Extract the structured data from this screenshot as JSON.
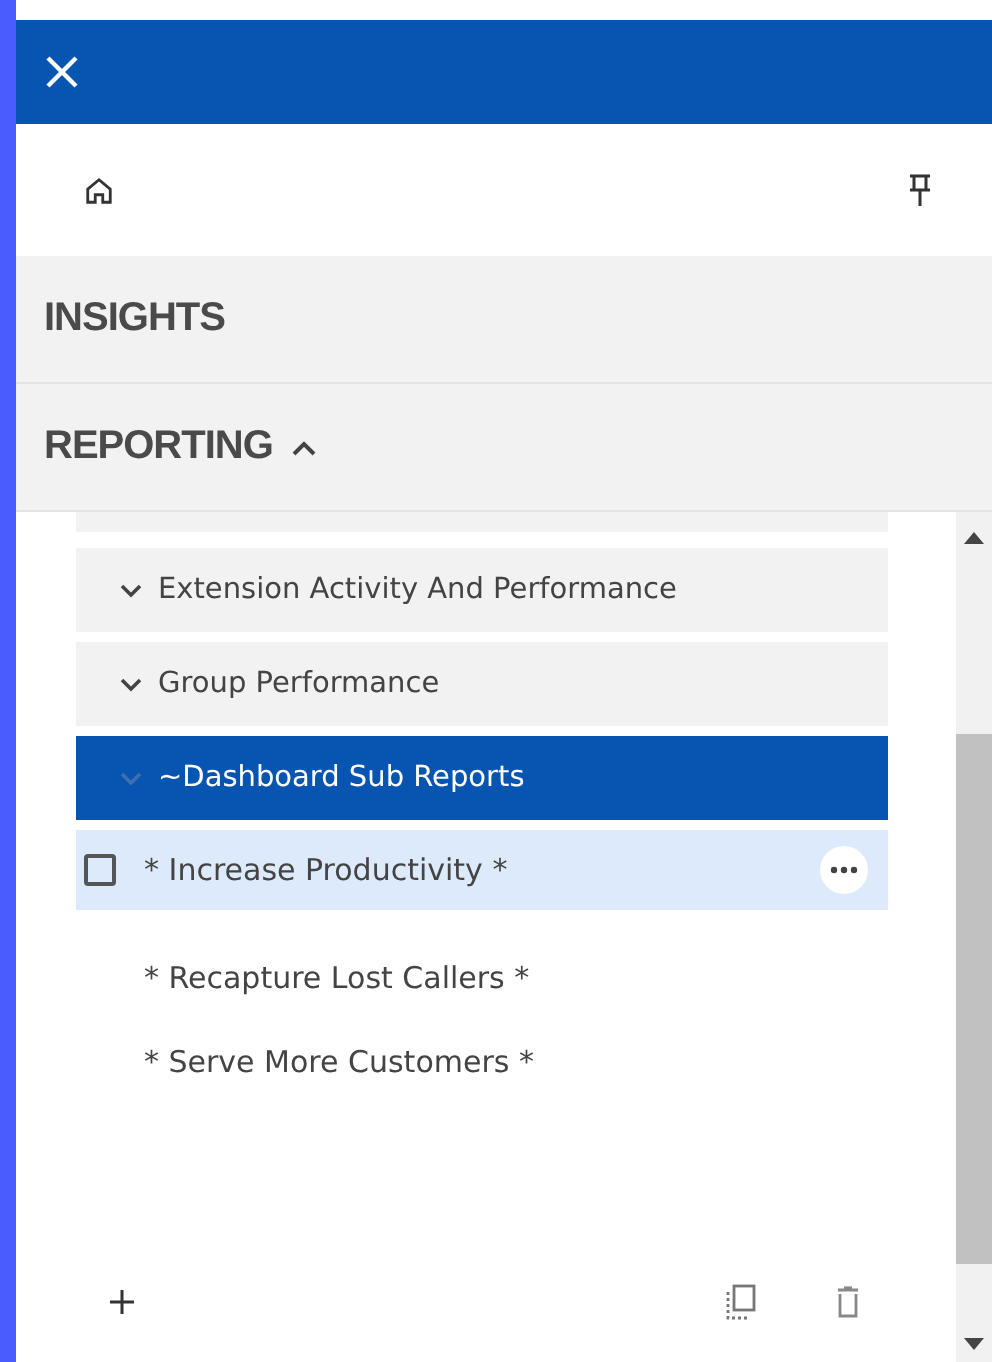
{
  "sections": [
    {
      "label": "INSIGHTS"
    },
    {
      "label": "REPORTING",
      "expanded": true
    }
  ],
  "folders": [
    {
      "label": "Extension Activity And Performance",
      "selected": false
    },
    {
      "label": "Group Performance",
      "selected": false
    },
    {
      "label": "~Dashboard Sub Reports",
      "selected": true
    }
  ],
  "reports": [
    {
      "label": "* Increase Productivity *",
      "selected": true,
      "checked": false
    },
    {
      "label": "* Recapture Lost Callers *",
      "selected": false
    },
    {
      "label": "* Serve More Customers *",
      "selected": false
    }
  ]
}
